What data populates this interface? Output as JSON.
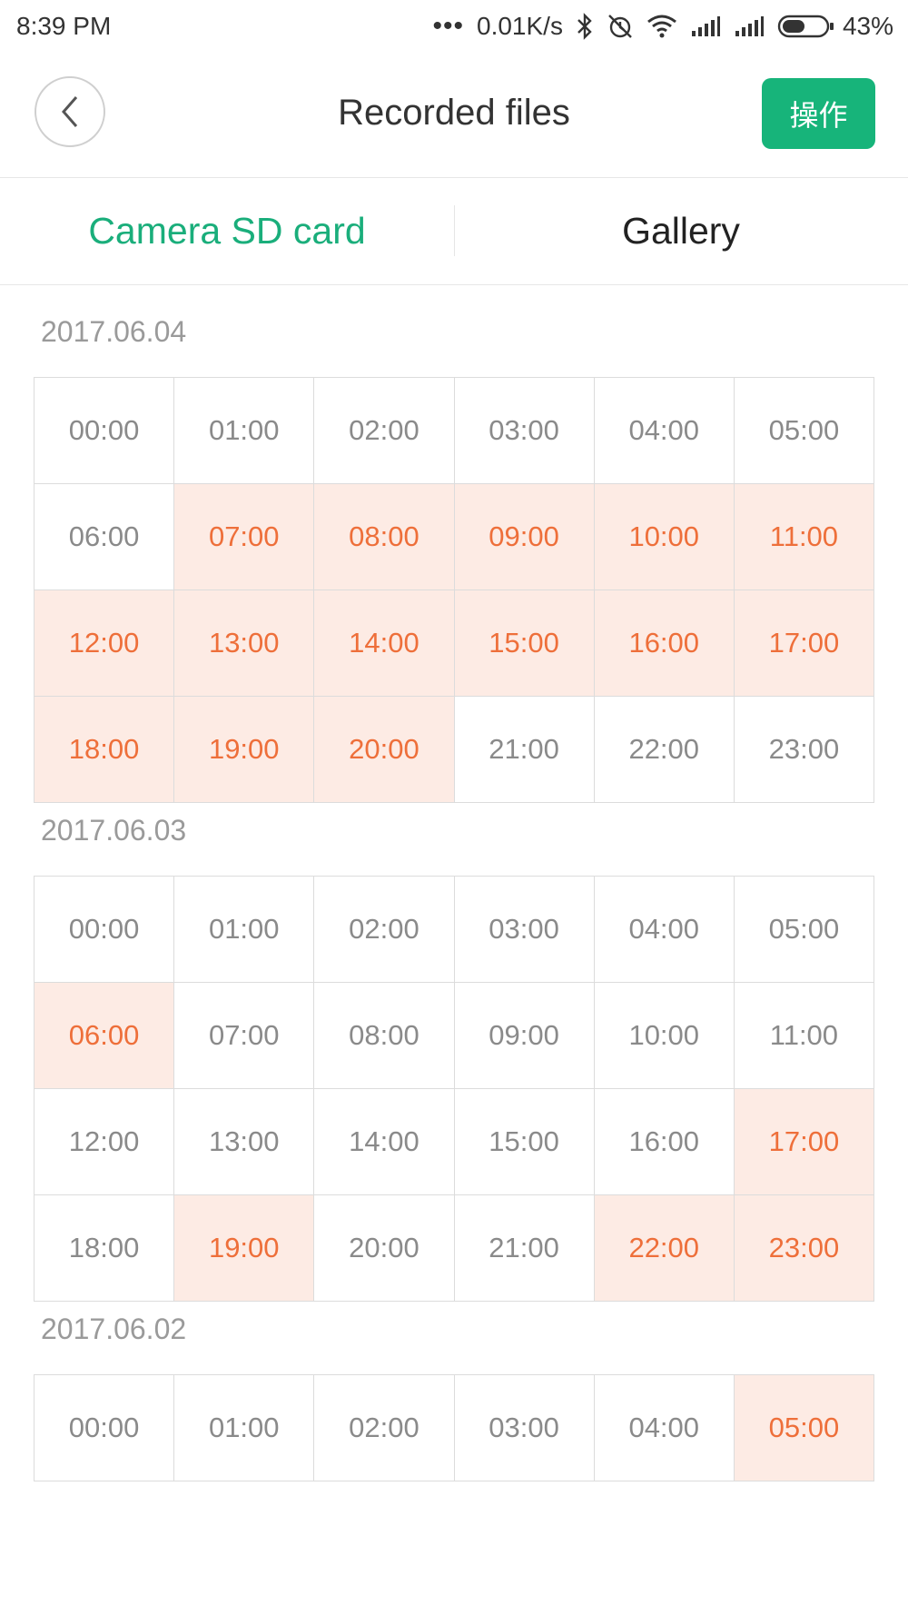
{
  "status_bar": {
    "time": "8:39 PM",
    "net_speed": "0.01K/s",
    "battery_percent": "43%",
    "battery_level": 0.43
  },
  "header": {
    "title": "Recorded files",
    "action_label": "操作"
  },
  "tabs": [
    {
      "label": "Camera SD card",
      "active": true
    },
    {
      "label": "Gallery",
      "active": false
    }
  ],
  "days": [
    {
      "date": "2017.06.04",
      "hours": [
        {
          "label": "00:00",
          "recorded": false
        },
        {
          "label": "01:00",
          "recorded": false
        },
        {
          "label": "02:00",
          "recorded": false
        },
        {
          "label": "03:00",
          "recorded": false
        },
        {
          "label": "04:00",
          "recorded": false
        },
        {
          "label": "05:00",
          "recorded": false
        },
        {
          "label": "06:00",
          "recorded": false
        },
        {
          "label": "07:00",
          "recorded": true
        },
        {
          "label": "08:00",
          "recorded": true
        },
        {
          "label": "09:00",
          "recorded": true
        },
        {
          "label": "10:00",
          "recorded": true
        },
        {
          "label": "11:00",
          "recorded": true
        },
        {
          "label": "12:00",
          "recorded": true
        },
        {
          "label": "13:00",
          "recorded": true
        },
        {
          "label": "14:00",
          "recorded": true
        },
        {
          "label": "15:00",
          "recorded": true
        },
        {
          "label": "16:00",
          "recorded": true
        },
        {
          "label": "17:00",
          "recorded": true
        },
        {
          "label": "18:00",
          "recorded": true
        },
        {
          "label": "19:00",
          "recorded": true
        },
        {
          "label": "20:00",
          "recorded": true
        },
        {
          "label": "21:00",
          "recorded": false
        },
        {
          "label": "22:00",
          "recorded": false
        },
        {
          "label": "23:00",
          "recorded": false
        }
      ]
    },
    {
      "date": "2017.06.03",
      "hours": [
        {
          "label": "00:00",
          "recorded": false
        },
        {
          "label": "01:00",
          "recorded": false
        },
        {
          "label": "02:00",
          "recorded": false
        },
        {
          "label": "03:00",
          "recorded": false
        },
        {
          "label": "04:00",
          "recorded": false
        },
        {
          "label": "05:00",
          "recorded": false
        },
        {
          "label": "06:00",
          "recorded": true
        },
        {
          "label": "07:00",
          "recorded": false
        },
        {
          "label": "08:00",
          "recorded": false
        },
        {
          "label": "09:00",
          "recorded": false
        },
        {
          "label": "10:00",
          "recorded": false
        },
        {
          "label": "11:00",
          "recorded": false
        },
        {
          "label": "12:00",
          "recorded": false
        },
        {
          "label": "13:00",
          "recorded": false
        },
        {
          "label": "14:00",
          "recorded": false
        },
        {
          "label": "15:00",
          "recorded": false
        },
        {
          "label": "16:00",
          "recorded": false
        },
        {
          "label": "17:00",
          "recorded": true
        },
        {
          "label": "18:00",
          "recorded": false
        },
        {
          "label": "19:00",
          "recorded": true
        },
        {
          "label": "20:00",
          "recorded": false
        },
        {
          "label": "21:00",
          "recorded": false
        },
        {
          "label": "22:00",
          "recorded": true
        },
        {
          "label": "23:00",
          "recorded": true
        }
      ]
    },
    {
      "date": "2017.06.02",
      "hours": [
        {
          "label": "00:00",
          "recorded": false
        },
        {
          "label": "01:00",
          "recorded": false
        },
        {
          "label": "02:00",
          "recorded": false
        },
        {
          "label": "03:00",
          "recorded": false
        },
        {
          "label": "04:00",
          "recorded": false
        },
        {
          "label": "05:00",
          "recorded": true
        }
      ]
    }
  ]
}
